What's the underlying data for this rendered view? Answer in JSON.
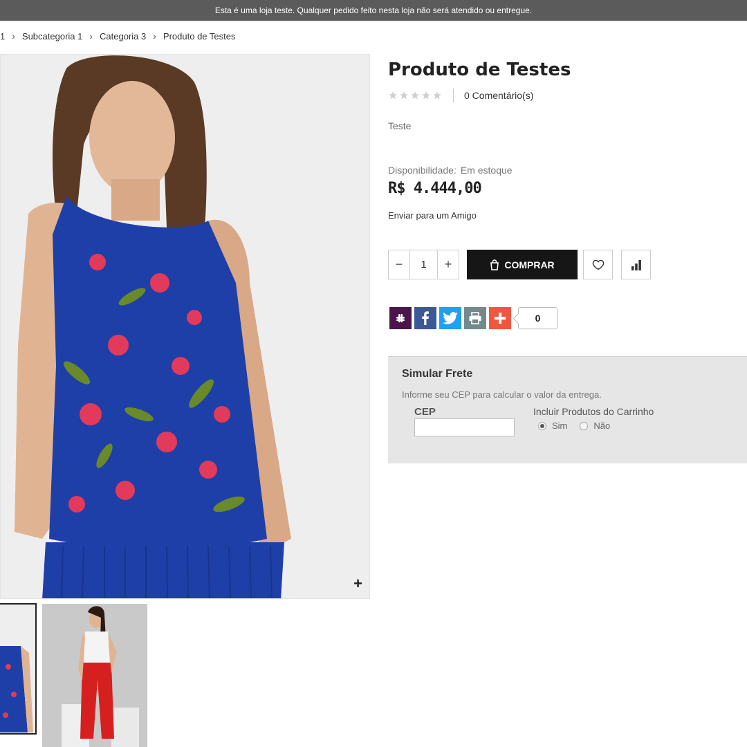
{
  "notice": "Esta é uma loja teste. Qualquer pedido feito nesta loja não será atendido ou entregue.",
  "breadcrumb": [
    "1",
    "Subcategoria 1",
    "Categoria 3",
    "Produto de Testes"
  ],
  "product": {
    "title": "Produto de Testes",
    "rating_stars": 0,
    "comments": "0 Comentário(s)",
    "short_description": "Teste",
    "availability_label": "Disponibilidade:",
    "availability_value": "Em estoque",
    "price": "R$ 4.444,00",
    "email_friend": "Enviar para um Amigo",
    "quantity": "1",
    "buy_label": "COMPRAR"
  },
  "icons": {
    "wishlist": "heart-icon",
    "compare": "bar-chart-icon",
    "zoom": "plus-icon",
    "buy": "shopping-bag-icon"
  },
  "share": {
    "buttons": [
      "slack",
      "facebook",
      "twitter",
      "print",
      "more"
    ],
    "colors": {
      "slack": "#4a154b",
      "facebook": "#3b5998",
      "twitter": "#1da1f2",
      "print": "#738a8d",
      "more": "#f0573e"
    },
    "count": "0"
  },
  "shipping": {
    "title": "Simular Frete",
    "description": "Informe seu CEP para calcular o valor da entrega.",
    "cep_label": "CEP",
    "cep_value": "",
    "include_label": "Incluir Produtos do Carrinho",
    "options": [
      "Sim",
      "Não"
    ],
    "selected": "Sim"
  },
  "colors": {
    "topbar": "#5b5b5b",
    "buy_button": "#161616",
    "shipping_bg": "#e6e6e6"
  }
}
